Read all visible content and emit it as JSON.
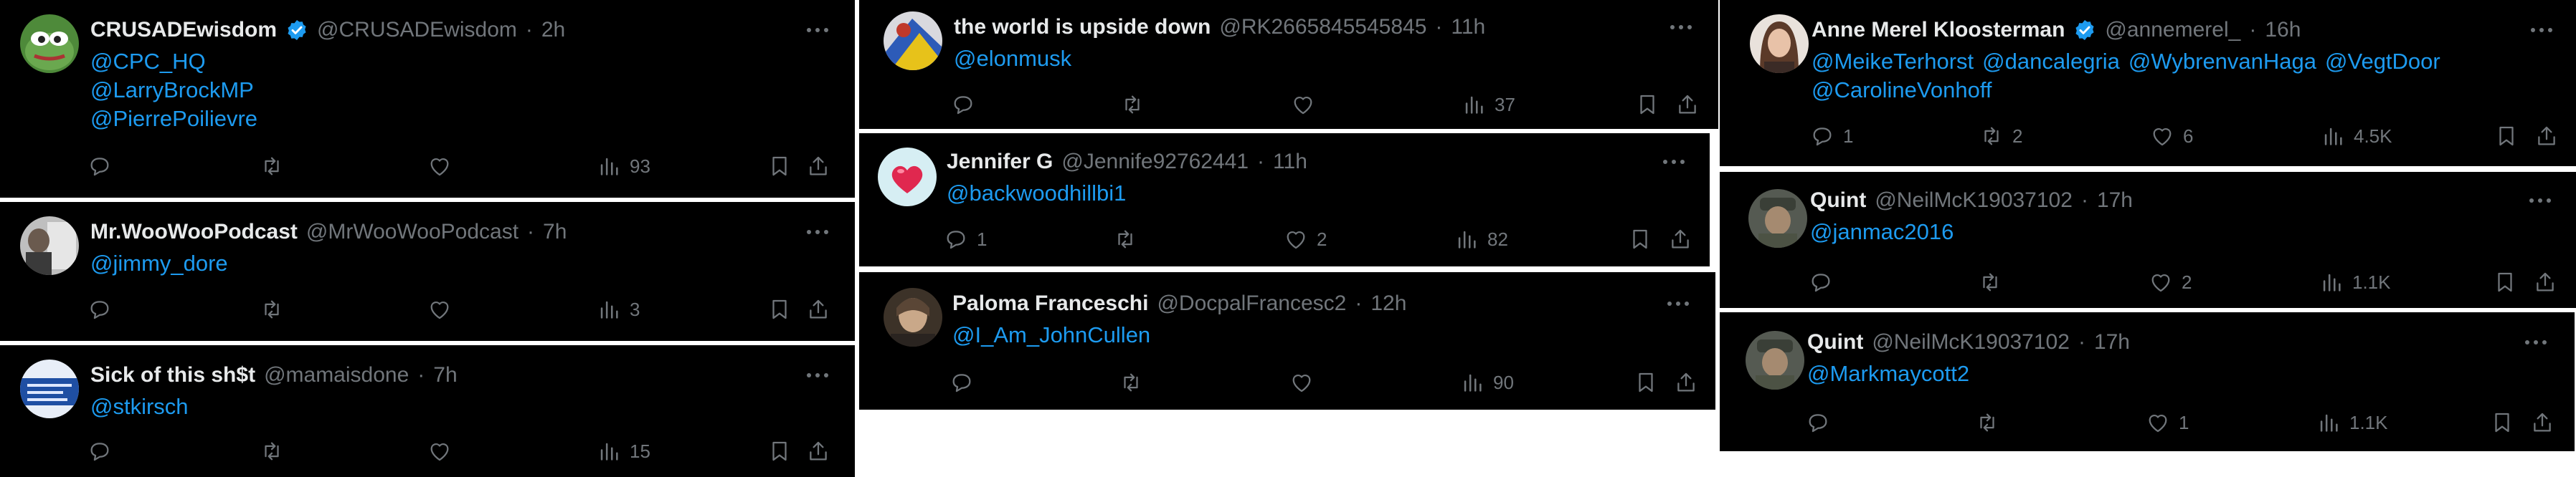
{
  "colors": {
    "background": "#000000",
    "text": "#e7e9ea",
    "muted": "#71767b",
    "link": "#1d9bf0",
    "verified": "#1d9bf0"
  },
  "icons": {
    "more": "more-dots-icon",
    "reply": "reply-icon",
    "retweet": "retweet-icon",
    "like": "like-icon",
    "views": "views-chart-icon",
    "bookmark": "bookmark-icon",
    "share": "share-icon",
    "verified": "verified-badge-icon"
  },
  "tweets": [
    {
      "name": "CRUSADEwisdom",
      "handle": "@CRUSADEwisdom",
      "dot": "·",
      "time": "2h",
      "mentions": [
        "@CPC_HQ",
        "@LarryBrockMP",
        "@PierrePoilievre"
      ],
      "replies": "",
      "retweets": "",
      "likes": "",
      "views": "93"
    },
    {
      "name": "Mr.WooWooPodcast",
      "handle": "@MrWooWooPodcast",
      "dot": "·",
      "time": "7h",
      "mentions": [
        "@jimmy_dore"
      ],
      "replies": "",
      "retweets": "",
      "likes": "",
      "views": "3"
    },
    {
      "name": "Sick of this sh$t",
      "handle": "@mamaisdone",
      "dot": "·",
      "time": "7h",
      "mentions": [
        "@stkirsch"
      ],
      "replies": "",
      "retweets": "",
      "likes": "",
      "views": "15"
    },
    {
      "name": "the world is upside down",
      "handle": "@RK2665845545845",
      "dot": "·",
      "time": "11h",
      "mentions": [
        "@elonmusk"
      ],
      "replies": "",
      "retweets": "",
      "likes": "",
      "views": "37"
    },
    {
      "name": "Jennifer G",
      "handle": "@Jennife92762441",
      "dot": "·",
      "time": "11h",
      "mentions": [
        "@backwoodhillbi1"
      ],
      "replies": "1",
      "retweets": "",
      "likes": "2",
      "views": "82"
    },
    {
      "name": "Paloma Franceschi",
      "handle": "@DocpalFrancesc2",
      "dot": "·",
      "time": "12h",
      "mentions": [
        "@I_Am_JohnCullen"
      ],
      "replies": "",
      "retweets": "",
      "likes": "",
      "views": "90"
    },
    {
      "name": "Anne Merel Kloosterman",
      "handle": "@annemerel_",
      "dot": "·",
      "time": "16h",
      "mentions": [
        "@MeikeTerhorst",
        "@dancalegria",
        "@WybrenvanHaga",
        "@VegtDoor",
        "@CarolineVonhoff"
      ],
      "replies": "1",
      "retweets": "2",
      "likes": "6",
      "views": "4.5K"
    },
    {
      "name": "Quint",
      "handle": "@NeilMcK19037102",
      "dot": "·",
      "time": "17h",
      "mentions": [
        "@janmac2016"
      ],
      "replies": "",
      "retweets": "",
      "likes": "2",
      "views": "1.1K"
    },
    {
      "name": "Quint",
      "handle": "@NeilMcK19037102",
      "dot": "·",
      "time": "17h",
      "mentions": [
        "@Markmaycott2"
      ],
      "replies": "",
      "retweets": "",
      "likes": "1",
      "views": "1.1K"
    }
  ]
}
